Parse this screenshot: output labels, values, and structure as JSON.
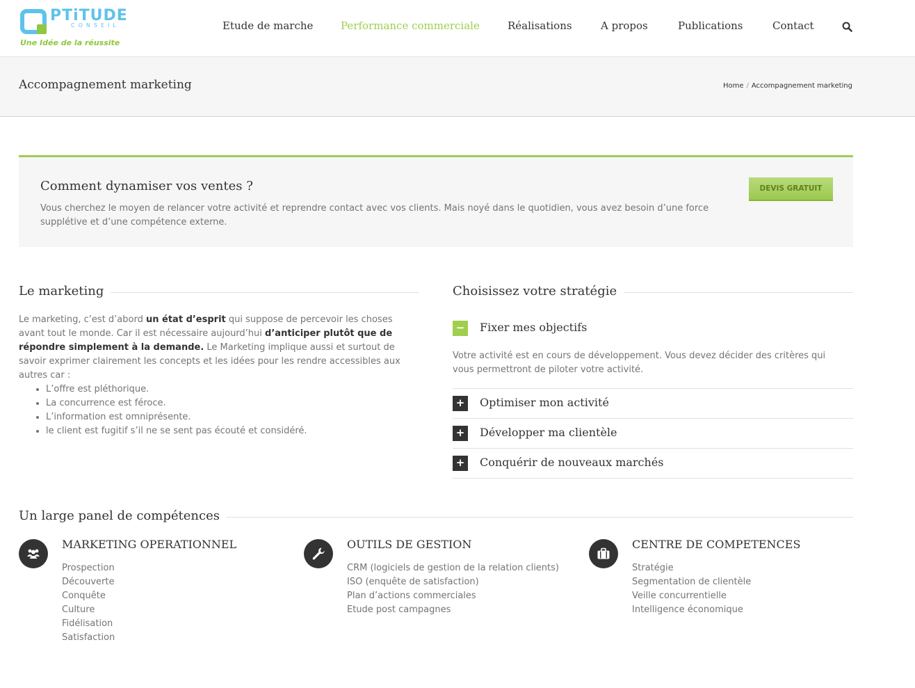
{
  "header": {
    "logo": {
      "word": "PTiTUDE",
      "sub": "CONSEIL",
      "tagline": "Une Idée de la réussite"
    },
    "nav": [
      {
        "label": "Etude de marche"
      },
      {
        "label": "Performance commerciale",
        "active": true
      },
      {
        "label": "Réalisations"
      },
      {
        "label": "A propos"
      },
      {
        "label": "Publications"
      },
      {
        "label": "Contact"
      }
    ],
    "search_icon": "search-icon"
  },
  "title_bar": {
    "title": "Accompagnement marketing",
    "breadcrumb": {
      "home": "Home",
      "separator": "/",
      "current": "Accompagnement marketing"
    }
  },
  "promo": {
    "title": "Comment dynamiser vos ventes ?",
    "text": "Vous cherchez le moyen de relancer votre activité et reprendre contact avec vos clients. Mais noyé dans le quotidien, vous avez besoin d’une force supplétive et d’une compétence externe.",
    "button": "DEVIS GRATUIT"
  },
  "marketing": {
    "title": "Le marketing",
    "p1": "Le marketing, c’est d’abord ",
    "b1": "un état d’esprit",
    "p2": " qui suppose de percevoir les choses avant tout le monde. Car il est nécessaire aujourd’hui ",
    "b2": "d’anticiper plutôt que de répondre simplement à la demande.",
    "p3": " Le Marketing implique aussi et surtout de savoir exprimer clairement les concepts et les idées pour les rendre accessibles aux autres car :",
    "list": [
      "L’offre est pléthorique.",
      "La concurrence est féroce.",
      "L’information est omniprésente.",
      "le client est fugitif s’il ne se sent pas écouté et considéré."
    ]
  },
  "strategy": {
    "title": "Choisissez votre stratégie",
    "items": [
      {
        "label": "Fixer mes objectifs",
        "toggle": "−",
        "open": true,
        "body": "Votre activité est en cours de développement. Vous devez décider des critères qui vous permettront de piloter votre activité."
      },
      {
        "label": "Optimiser mon activité",
        "toggle": "+"
      },
      {
        "label": "Développer ma clientèle",
        "toggle": "+"
      },
      {
        "label": "Conquérir de nouveaux marchés",
        "toggle": "+"
      }
    ]
  },
  "competences": {
    "title": "Un large panel de compétences",
    "columns": [
      {
        "icon": "users-icon",
        "title": "MARKETING OPERATIONNEL",
        "items": [
          "Prospection",
          "Découverte",
          "Conquête",
          "Culture",
          "Fidélisation",
          "Satisfaction"
        ]
      },
      {
        "icon": "wrench-icon",
        "title": "OUTILS DE GESTION",
        "items": [
          "CRM (logiciels de gestion de la relation clients)",
          "ISO (enquête de satisfaction)",
          "Plan d’actions commerciales",
          "Etude post campagnes"
        ]
      },
      {
        "icon": "briefcase-icon",
        "title": "CENTRE DE COMPETENCES",
        "items": [
          "Stratégie",
          "Segmentation de clientèle",
          "Veille concurrentielle",
          "Intelligence économique"
        ]
      }
    ]
  },
  "colors": {
    "accent_green": "#a0ce4e",
    "logo_blue": "#5ec3ea",
    "logo_green": "#8fc740",
    "dark": "#333333",
    "text": "#747474"
  }
}
